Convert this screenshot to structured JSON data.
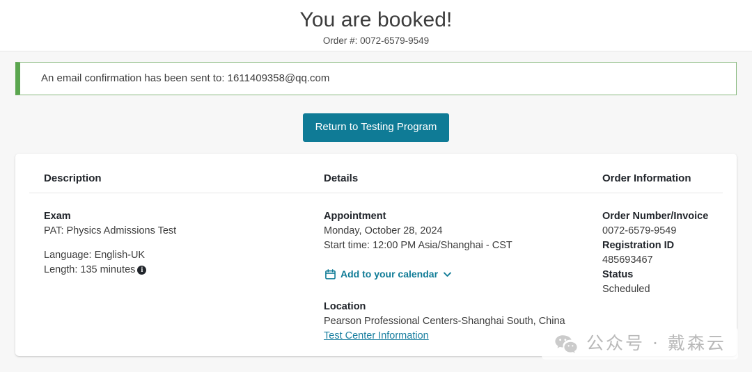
{
  "header": {
    "title": "You are booked!",
    "order_subtitle": "Order #: 0072-6579-9549"
  },
  "alert": {
    "message": "An email confirmation has been sent to: 1611409358@qq.com",
    "accent_color": "#5ba64f",
    "border_color": "#86b87d"
  },
  "actions": {
    "return_button_label": "Return to Testing Program",
    "primary_color": "#0f7b96"
  },
  "card": {
    "columns": [
      {
        "heading": "Description"
      },
      {
        "heading": "Details"
      },
      {
        "heading": "Order Information"
      }
    ],
    "description": {
      "exam_label": "Exam",
      "exam_name": "PAT: Physics Admissions Test",
      "language": "Language: English-UK",
      "length": "Length: 135 minutes",
      "info_icon_glyph": "i"
    },
    "details": {
      "appointment_label": "Appointment",
      "appointment_date": "Monday, October 28, 2024",
      "start_time": "Start time: 12:00 PM Asia/Shanghai - CST",
      "calendar_link_label": "Add to your calendar",
      "location_label": "Location",
      "location_value": "Pearson Professional Centers-Shanghai South, China",
      "test_center_link": "Test Center Information"
    },
    "order_information": {
      "order_number_label": "Order Number/Invoice",
      "order_number_value": "0072-6579-9549",
      "registration_id_label": "Registration ID",
      "registration_id_value": "485693467",
      "status_label": "Status",
      "status_value": "Scheduled"
    }
  },
  "watermark": {
    "text": "公众号 · 戴森云"
  }
}
